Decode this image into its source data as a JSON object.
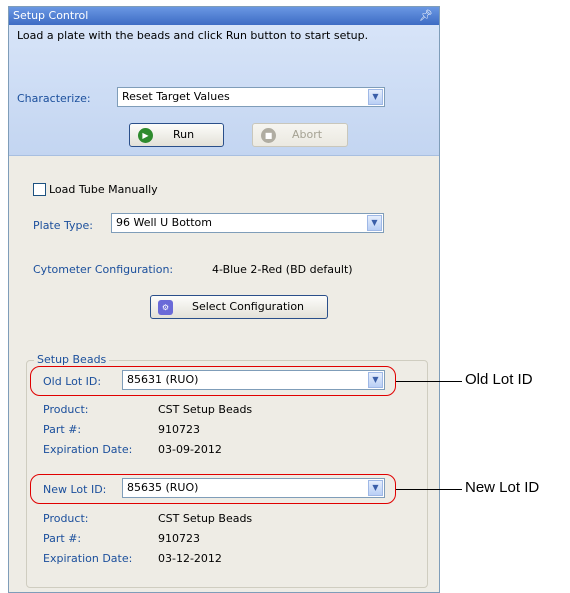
{
  "panel": {
    "title": "Setup Control",
    "pin_icon": "pin-icon",
    "instruction": "Load a plate with the beads and click Run button to start setup."
  },
  "characterize": {
    "label": "Characterize:",
    "value": "Reset Target Values"
  },
  "buttons": {
    "run": "Run",
    "abort": "Abort",
    "select_configuration": "Select Configuration"
  },
  "load_tube": {
    "label": "Load Tube Manually",
    "checked": false
  },
  "plate_type": {
    "label": "Plate Type:",
    "value": "96 Well U Bottom"
  },
  "cytometer": {
    "label": "Cytometer Configuration:",
    "value": "4-Blue 2-Red (BD default)"
  },
  "setup_beads": {
    "title": "Setup Beads",
    "old_lot": {
      "label": "Old Lot ID:",
      "value": "85631 (RUO)",
      "product_label": "Product:",
      "product": "CST Setup Beads",
      "part_label": "Part #:",
      "part": "910723",
      "exp_label": "Expiration Date:",
      "exp": "03-09-2012"
    },
    "new_lot": {
      "label": "New Lot ID:",
      "value": "85635 (RUO)",
      "product_label": "Product:",
      "product": "CST Setup Beads",
      "part_label": "Part #:",
      "part": "910723",
      "exp_label": "Expiration Date:",
      "exp": "03-12-2012"
    }
  },
  "callouts": {
    "old": "Old Lot ID",
    "new": "New Lot ID"
  },
  "colors": {
    "titlebar": "#3d6cc4",
    "label_blue": "#1b4f9c",
    "highlight_red": "#e00000"
  }
}
